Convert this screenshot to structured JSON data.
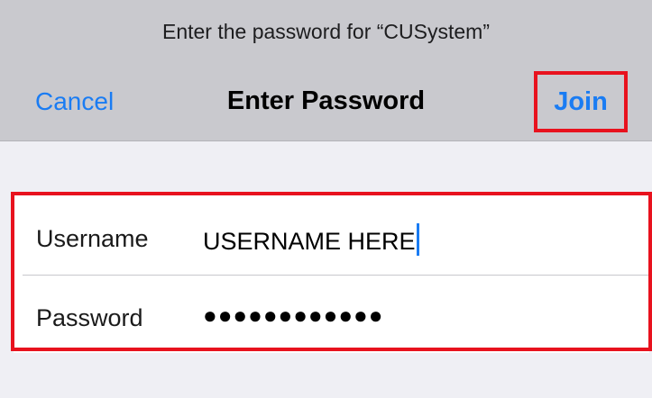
{
  "dialog": {
    "prompt": "Enter the password for “CUSystem”",
    "cancel_label": "Cancel",
    "title": "Enter Password",
    "join_label": "Join"
  },
  "form": {
    "username": {
      "label": "Username",
      "value": "USERNAME HERE"
    },
    "password": {
      "label": "Password",
      "value": "●●●●●●●●●●●●"
    }
  },
  "colors": {
    "accent": "#1a7cf3",
    "highlight": "#e8121e",
    "header_bg": "#c9c9ce",
    "page_bg": "#efeff4"
  }
}
